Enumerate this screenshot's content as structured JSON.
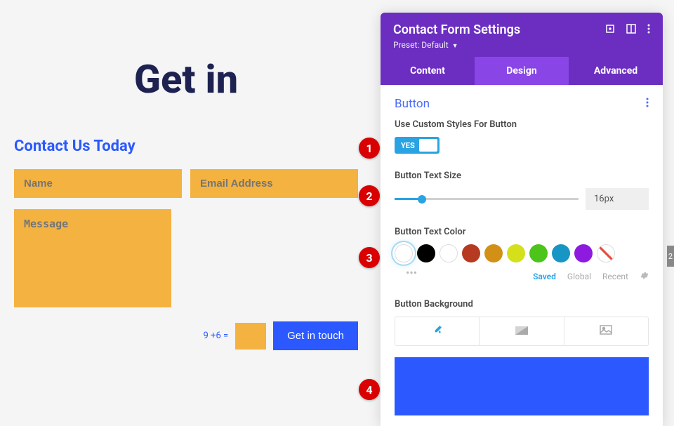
{
  "preview": {
    "page_title": "Get in",
    "form_title": "Contact Us Today",
    "name_placeholder": "Name",
    "email_placeholder": "Email Address",
    "message_placeholder": "Message",
    "captcha_text": "9 +6 =",
    "submit_label": "Get in touch"
  },
  "panel": {
    "title": "Contact Form Settings",
    "preset_label": "Preset:",
    "preset_value": "Default",
    "tabs": {
      "content": "Content",
      "design": "Design",
      "advanced": "Advanced"
    },
    "section": "Button",
    "settings": {
      "use_custom_label": "Use Custom Styles For Button",
      "toggle_text": "YES",
      "text_size_label": "Button Text Size",
      "text_size_value": "16px",
      "text_color_label": "Button Text Color",
      "palette_tabs": {
        "saved": "Saved",
        "global": "Global",
        "recent": "Recent"
      },
      "bg_label": "Button Background"
    }
  },
  "markers": {
    "m1": "1",
    "m2": "2",
    "m3": "3",
    "m4": "4"
  },
  "colors": {
    "selected": "#ffffff",
    "black": "#000000",
    "white": "#ffffff",
    "rust": "#b53a1f",
    "amber": "#d39016",
    "lime": "#d4e01a",
    "green": "#4cc41a",
    "teal": "#1795c4",
    "purple": "#8e1ae0",
    "bg_preview": "#2b59ff"
  }
}
